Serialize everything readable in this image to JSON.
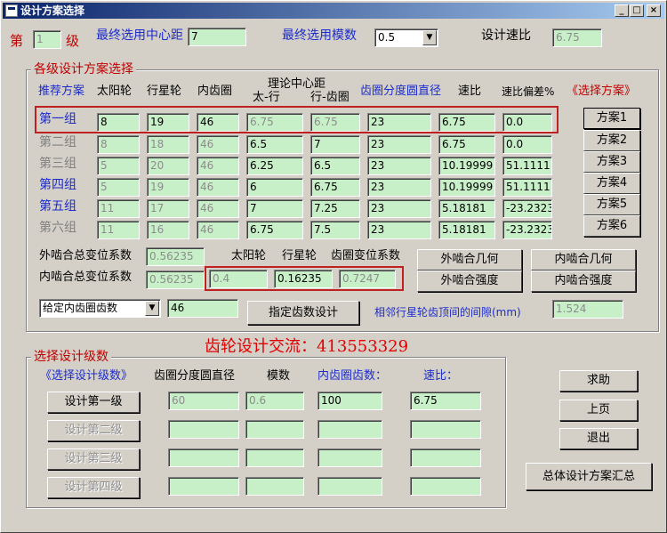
{
  "window": {
    "title": "设计方案选择",
    "buttons": [
      "_",
      "□",
      "×"
    ]
  },
  "top": {
    "level_prefix": "第",
    "level_value": "1",
    "level_suffix": "级",
    "center_distance_label": "最终选用中心距",
    "center_distance_value": "7",
    "module_label": "最终选用模数",
    "module_value": "0.5",
    "ratio_label": "设计速比",
    "ratio_value": "6.75"
  },
  "schemes_group": {
    "title": "各级设计方案选择",
    "headers": {
      "recommend": "推荐方案",
      "sun": "太阳轮",
      "planet": "行星轮",
      "ring": "内齿圈",
      "theory_center_top": "理论中心距",
      "theory_sun_planet": "太-行",
      "theory_planet_ring": "行-齿圈",
      "ring_pitch_diameter": "齿圈分度圆直径",
      "ratio": "速比",
      "ratio_error": "速比偏差%",
      "select": "《选择方案》"
    },
    "rows": [
      {
        "label": "第一组",
        "sun": "8",
        "planet": "19",
        "ring": "46",
        "c1": "6.75",
        "c2": "6.75",
        "d": "23",
        "ratio": "6.75",
        "err": "0.0",
        "button": "方案1"
      },
      {
        "label": "第二组",
        "sun": "8",
        "planet": "18",
        "ring": "46",
        "c1": "6.5",
        "c2": "7",
        "d": "23",
        "ratio": "6.75",
        "err": "0.0",
        "button": "方案2"
      },
      {
        "label": "第三组",
        "sun": "5",
        "planet": "20",
        "ring": "46",
        "c1": "6.25",
        "c2": "6.5",
        "d": "23",
        "ratio": "10.19999",
        "err": "51.1111",
        "button": "方案3"
      },
      {
        "label": "第四组",
        "sun": "5",
        "planet": "19",
        "ring": "46",
        "c1": "6",
        "c2": "6.75",
        "d": "23",
        "ratio": "10.19999",
        "err": "51.1111",
        "button": "方案4"
      },
      {
        "label": "第五组",
        "sun": "11",
        "planet": "17",
        "ring": "46",
        "c1": "7",
        "c2": "7.25",
        "d": "23",
        "ratio": "5.18181",
        "err": "-23.2323",
        "button": "方案5"
      },
      {
        "label": "第六组",
        "sun": "11",
        "planet": "16",
        "ring": "46",
        "c1": "6.75",
        "c2": "7.5",
        "d": "23",
        "ratio": "5.18181",
        "err": "-23.2323",
        "button": "方案6"
      }
    ],
    "external_shift_label": "外啮合总变位系数",
    "external_shift_value": "0.56235",
    "internal_shift_label": "内啮合总变位系数",
    "internal_shift_value": "0.56235",
    "shift_headers": {
      "sun": "太阳轮",
      "planet": "行星轮",
      "ring": "齿圈变位系数"
    },
    "shift_values": {
      "sun": "0.4",
      "planet": "0.16235",
      "ring": "0.7247"
    },
    "buttons": {
      "ext_geom": "外啮合几何",
      "int_geom": "内啮合几何",
      "ext_strength": "外啮合强度",
      "int_strength": "内啮合强度"
    },
    "teeth_select": "给定内齿圈齿数",
    "teeth_value": "46",
    "assign_button": "指定齿数设计",
    "clearance_label": "相邻行星轮齿顶间的间隙(mm)",
    "clearance_value": "1.524"
  },
  "watermark": "齿轮设计交流：413553329",
  "levels_group": {
    "title": "选择设计级数",
    "headers": {
      "select": "《选择设计级数》",
      "diameter": "齿圈分度圆直径",
      "module": "模数",
      "teeth": "内齿圈齿数：",
      "ratio": "速比："
    },
    "rows": [
      {
        "button": "设计第一级",
        "diameter": "60",
        "module": "0.6",
        "teeth": "100",
        "ratio": "6.75"
      },
      {
        "button": "设计第二级",
        "diameter": "",
        "module": "",
        "teeth": "",
        "ratio": ""
      },
      {
        "button": "设计第三级",
        "diameter": "",
        "module": "",
        "teeth": "",
        "ratio": ""
      },
      {
        "button": "设计第四级",
        "diameter": "",
        "module": "",
        "teeth": "",
        "ratio": ""
      }
    ]
  },
  "side_buttons": {
    "help": "求助",
    "prev": "上页",
    "exit": "退出",
    "summary": "总体设计方案汇总"
  }
}
